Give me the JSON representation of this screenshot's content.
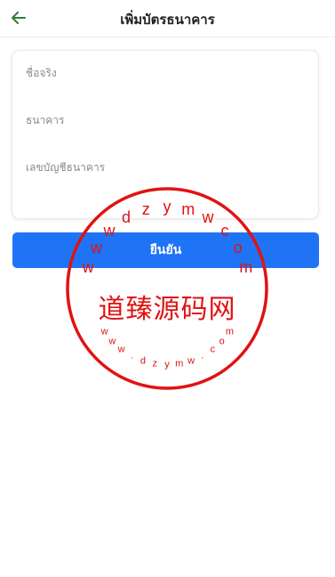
{
  "header": {
    "title": "เพิ่มบัตรธนาคาร",
    "back_icon": "arrow-left-icon",
    "back_color": "#2e7d32"
  },
  "form": {
    "name_placeholder": "ชื่อจริง",
    "bank_placeholder": "ธนาคาร",
    "account_placeholder": "เลขบัญชีธนาคาร"
  },
  "confirm": {
    "label": "ยืนยัน",
    "color": "#1e74f5"
  },
  "watermark": {
    "center_text": "道臻源码网",
    "top_text": "wwwdzymwcom",
    "bottom_text": "www.dzymw.com",
    "color": "#e11212"
  }
}
